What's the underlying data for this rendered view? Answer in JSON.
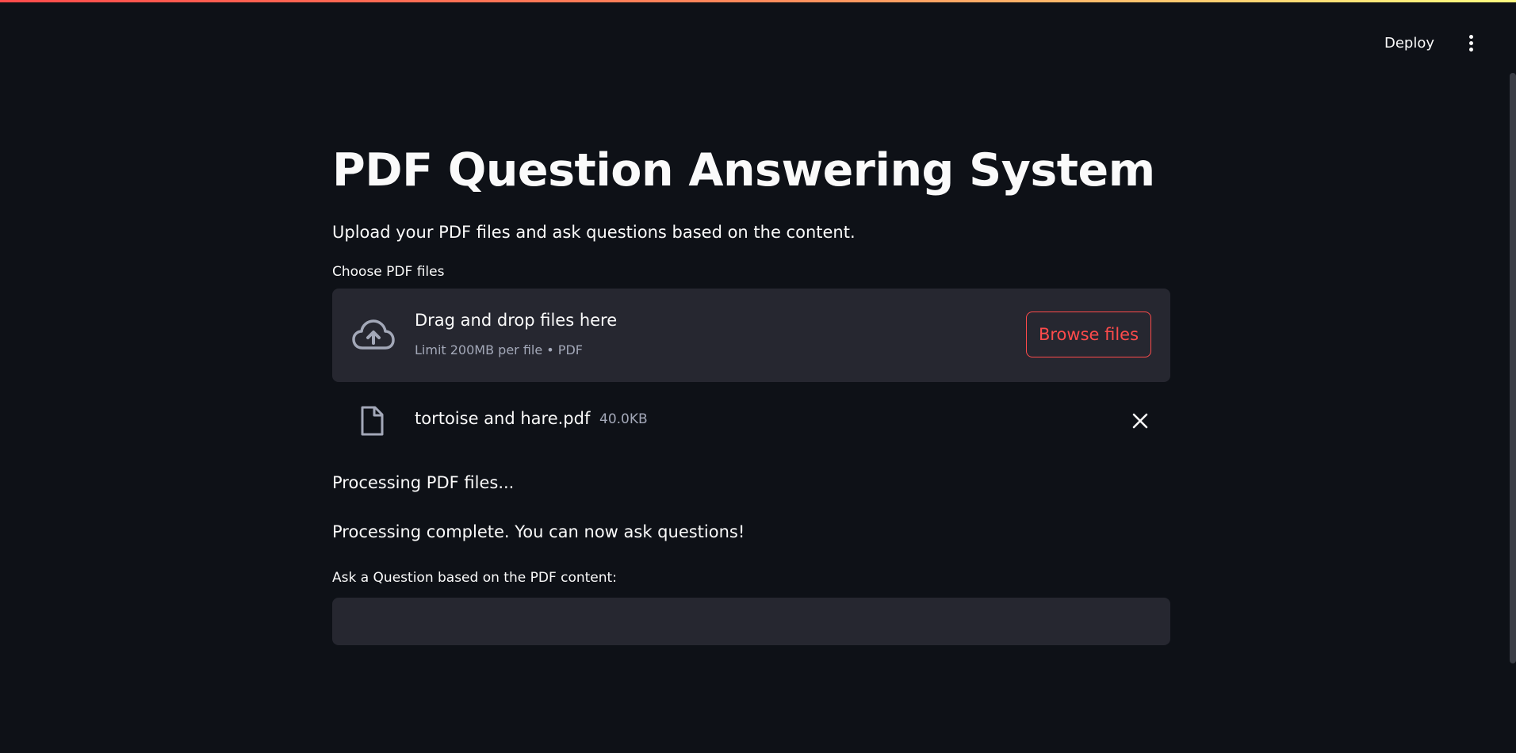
{
  "header": {
    "deploy_label": "Deploy"
  },
  "main": {
    "title": "PDF Question Answering System",
    "subtitle": "Upload your PDF files and ask questions based on the content.",
    "uploader": {
      "label": "Choose PDF files",
      "drop_text": "Drag and drop files here",
      "limit_text": "Limit 200MB per file • PDF",
      "browse_label": "Browse files"
    },
    "uploaded_file": {
      "name": "tortoise and hare.pdf",
      "size": "40.0KB"
    },
    "status_messages": [
      "Processing PDF files...",
      "Processing complete. You can now ask questions!"
    ],
    "question": {
      "label": "Ask a Question based on the PDF content:",
      "value": "",
      "placeholder": ""
    }
  },
  "colors": {
    "background": "#0e1117",
    "surface": "#262730",
    "accent": "#ff4b4b",
    "text": "#fafafa",
    "muted_text": "#a3a8b8"
  },
  "icons": {
    "menu": "vertical-ellipsis-icon",
    "upload": "cloud-upload-icon",
    "file": "file-icon",
    "remove": "close-icon"
  }
}
